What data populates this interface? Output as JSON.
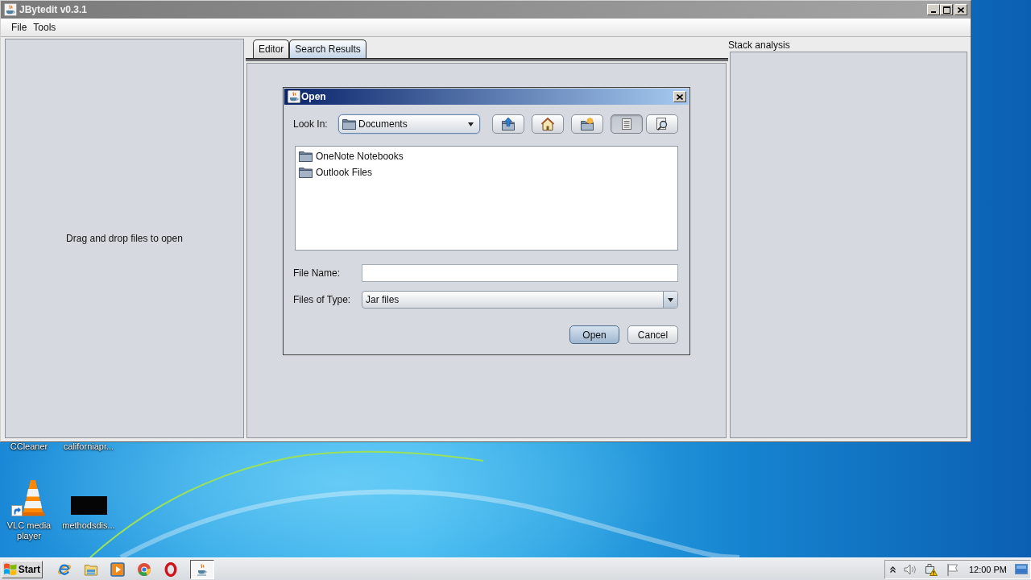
{
  "window": {
    "title": "JBytedit v0.3.1"
  },
  "menu": [
    {
      "label": "File"
    },
    {
      "label": "Tools"
    }
  ],
  "left_panel": {
    "message": "Drag and drop files to open"
  },
  "tabs": [
    {
      "label": "Editor",
      "selected": false
    },
    {
      "label": "Search Results",
      "selected": true
    }
  ],
  "right_panel": {
    "title": "Stack analysis"
  },
  "dialog": {
    "title": "Open",
    "look_in": {
      "label": "Look In:",
      "value": "Documents"
    },
    "toolbar": [
      {
        "kind": "up",
        "selected": false
      },
      {
        "kind": "home",
        "selected": false
      },
      {
        "kind": "new-folder",
        "selected": false
      },
      {
        "kind": "list",
        "selected": true
      },
      {
        "kind": "details",
        "selected": false
      }
    ],
    "files": [
      {
        "name": "OneNote Notebooks"
      },
      {
        "name": "Outlook Files"
      }
    ],
    "file_name": {
      "label": "File Name:"
    },
    "file_type": {
      "label": "Files of Type:",
      "value": "Jar files"
    },
    "buttons": [
      {
        "label": "Open",
        "default": true
      },
      {
        "label": "Cancel",
        "default": false
      }
    ]
  },
  "desktop": {
    "icons": [
      {
        "label": "CCleaner",
        "kind": "covered"
      },
      {
        "label": "californiapr...",
        "kind": "covered"
      },
      {
        "label": "VLC media player",
        "kind": "cone",
        "shortcut": true
      },
      {
        "label": "methodsdis...",
        "kind": "thumbnail",
        "shortcut": false
      }
    ]
  },
  "taskbar": {
    "start": "Start",
    "launchers": [
      {
        "kind": "ie"
      },
      {
        "kind": "explorer"
      },
      {
        "kind": "media"
      },
      {
        "kind": "chrome"
      },
      {
        "kind": "opera"
      }
    ],
    "tasks": [
      {
        "kind": "java",
        "selected": true
      }
    ],
    "tray": [
      {
        "kind": "chevron"
      },
      {
        "kind": "speaker"
      },
      {
        "kind": "network"
      },
      {
        "kind": "flag"
      }
    ],
    "clock": "12:00 PM"
  }
}
